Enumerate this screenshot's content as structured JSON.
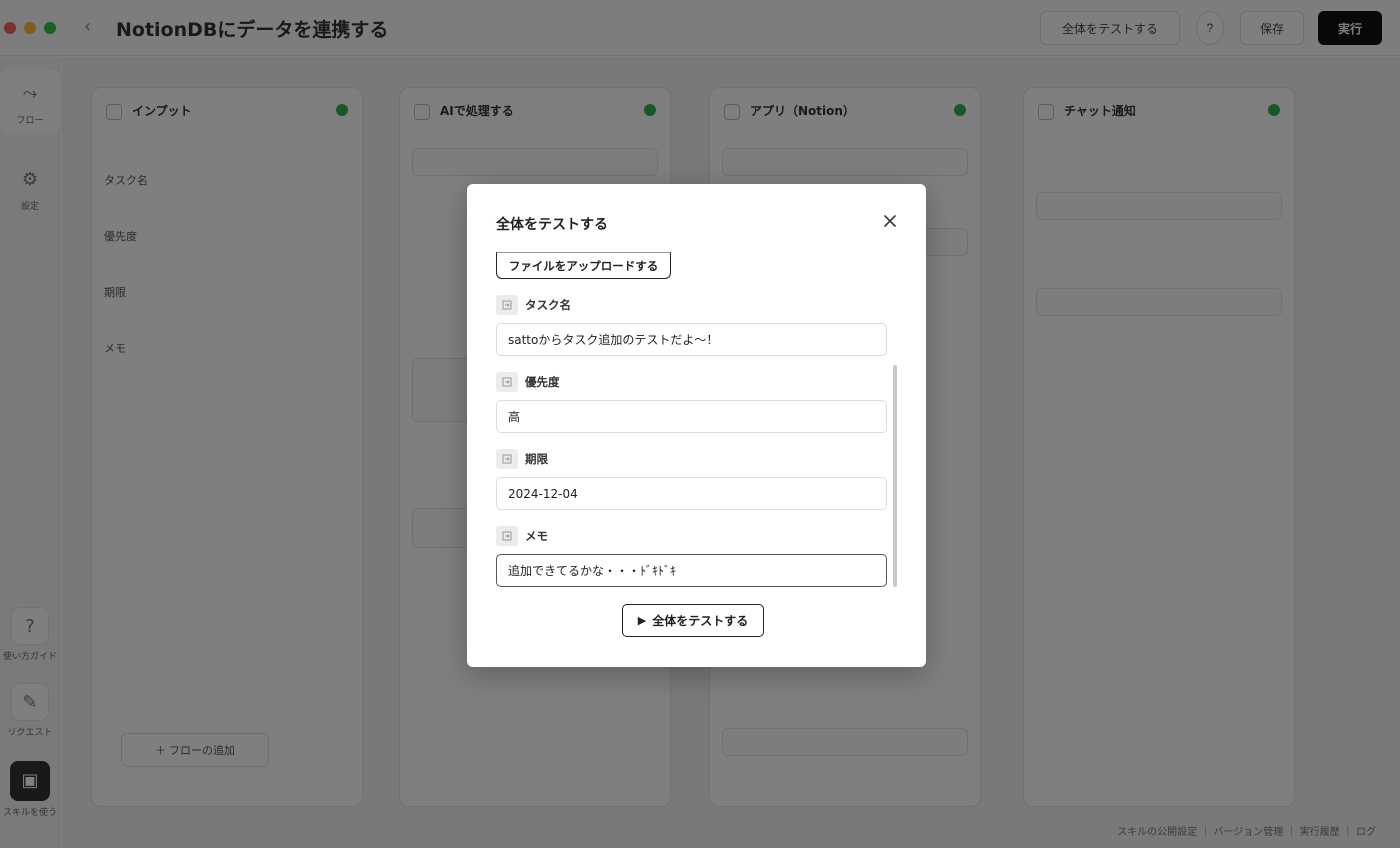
{
  "window": {
    "title": "NotionDBにデータを連携する"
  },
  "header": {
    "test_all_label": "全体をテストする",
    "help_label": "?",
    "save_label": "保存",
    "run_label": "実行"
  },
  "sidebar": {
    "flow_label": "フロー",
    "settings_label": "設定",
    "guide_label": "使い方ガイド",
    "request_label": "リクエスト",
    "skill_label": "スキルを使う"
  },
  "canvas": {
    "panels": [
      {
        "title": "インプット"
      },
      {
        "title": "AIで処理する"
      },
      {
        "title": "アプリ（Notion）"
      },
      {
        "title": "チャット通知"
      }
    ],
    "panel1_items": [
      "タスク名",
      "優先度",
      "期限",
      "メモ"
    ],
    "add_flow_label": "＋ フローの追加",
    "footer_note": "スキルの公開設定 ｜ バージョン管理 ｜ 実行履歴 ｜ ログ"
  },
  "modal": {
    "title": "全体をテストする",
    "upload_label": "ファイルをアップロードする",
    "fields": [
      {
        "label": "タスク名",
        "value": "sattoからタスク追加のテストだよ〜！"
      },
      {
        "label": "優先度",
        "value": "高"
      },
      {
        "label": "期限",
        "value": "2024-12-04"
      },
      {
        "label": "メモ",
        "value": "追加できてるかな・・・ﾄﾞｷﾄﾞｷ"
      }
    ],
    "run_label": "全体をテストする"
  },
  "icons": {
    "close": "close-icon",
    "field": "input-field-icon",
    "play": "play-icon"
  },
  "colors": {
    "accent_dark": "#111111",
    "status_green": "#2fb34a",
    "overlay": "rgba(0,0,0,0.5)"
  }
}
